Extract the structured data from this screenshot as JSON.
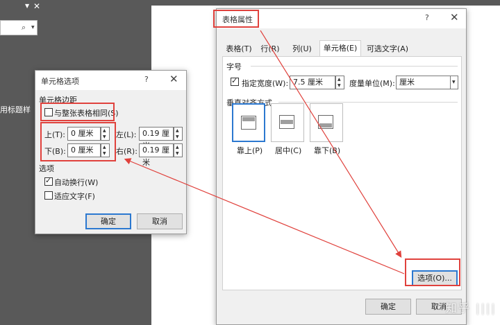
{
  "left_pane": {
    "search_icon": "⌕",
    "dropdown_icon": "▼",
    "close_icon": "✕",
    "partial_text": "用标题样"
  },
  "table_properties": {
    "title": "表格属性",
    "help": "?",
    "close": "✕",
    "tabs": [
      {
        "label": "表格(T)",
        "active": false
      },
      {
        "label": "行(R)",
        "active": false
      },
      {
        "label": "列(U)",
        "active": false
      },
      {
        "label": "单元格(E)",
        "active": true
      },
      {
        "label": "可选文字(A)",
        "active": false
      }
    ],
    "size_section": "字号",
    "specify_width_label": "指定宽度(W):",
    "specify_width_checked": true,
    "width_value": "7.5 厘米",
    "measure_label": "度量单位(M):",
    "measure_value": "厘米",
    "valign_section": "垂直对齐方式",
    "valign_options": [
      {
        "label": "靠上(P)",
        "active": true
      },
      {
        "label": "居中(C)",
        "active": false
      },
      {
        "label": "靠下(B)",
        "active": false
      }
    ],
    "options_button": "选项(O)...",
    "ok_button": "确定",
    "cancel_button": "取消"
  },
  "cell_options": {
    "title": "单元格选项",
    "help": "?",
    "close": "✕",
    "margins_section": "单元格边距",
    "same_as_table_label": "与整张表格相同(S)",
    "same_as_table_checked": false,
    "top_label": "上(T):",
    "top_value": "0 厘米",
    "bottom_label": "下(B):",
    "bottom_value": "0 厘米",
    "left_label": "左(L):",
    "left_value": "0.19 厘米",
    "right_label": "右(R):",
    "right_value": "0.19 厘米",
    "options_section": "选项",
    "wrap_label": "自动换行(W)",
    "wrap_checked": true,
    "fit_label": "适应文字(F)",
    "fit_checked": false,
    "ok_button": "确定",
    "cancel_button": "取消"
  },
  "watermark": "知乎 ||||",
  "colors": {
    "highlight": "#e0413c",
    "accent": "#2b78d0",
    "background": "#595959"
  }
}
